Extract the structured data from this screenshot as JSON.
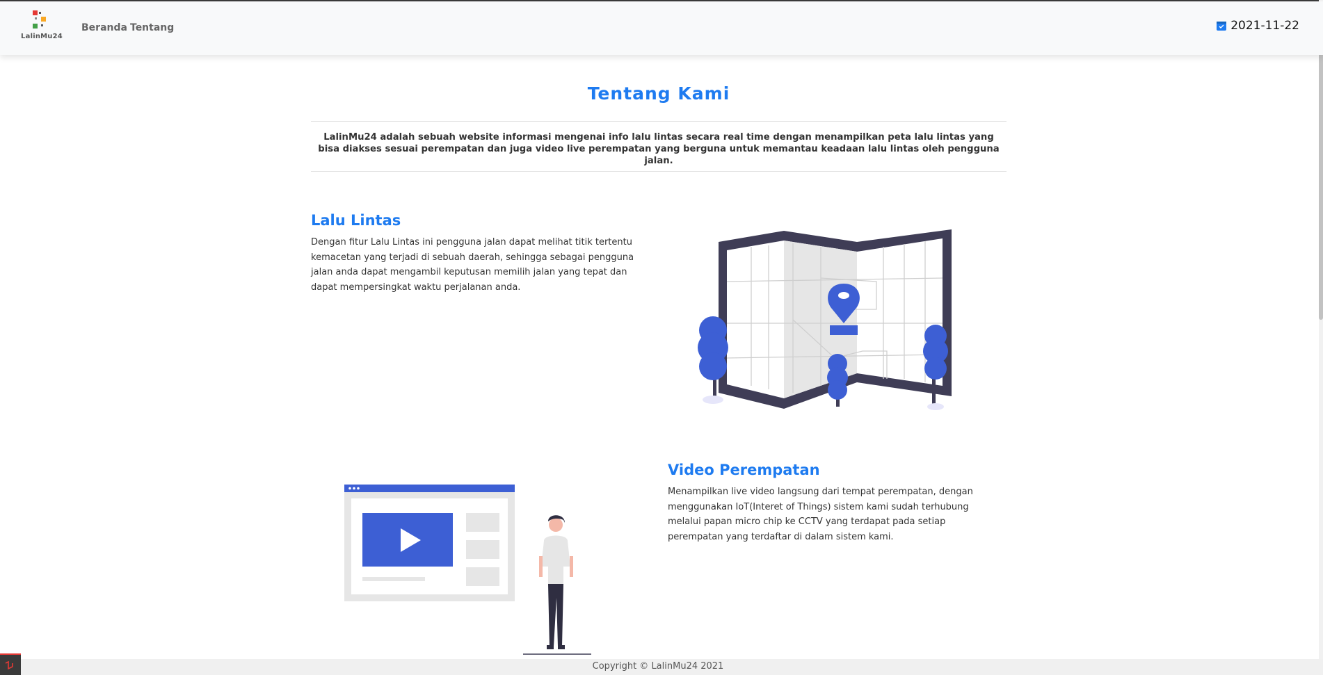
{
  "brand": {
    "name": "LalinMu24"
  },
  "nav": {
    "items": [
      {
        "label": "Beranda"
      },
      {
        "label": "Tentang"
      }
    ]
  },
  "header": {
    "date": "2021-11-22"
  },
  "about": {
    "title": "Tentang Kami",
    "intro": "LalinMu24 adalah sebuah website informasi mengenai info lalu lintas secara real time dengan menampilkan peta lalu lintas yang bisa diakses sesuai perempatan dan juga video live perempatan yang berguna untuk memantau keadaan lalu lintas oleh pengguna jalan."
  },
  "sections": [
    {
      "title": "Lalu Lintas",
      "text": "Dengan fitur Lalu Lintas ini pengguna jalan dapat melihat titik tertentu kemacetan yang terjadi di sebuah daerah, sehingga sebagai pengguna jalan anda dapat mengambil keputusan memilih jalan yang tepat dan dapat mempersingkat waktu perjalanan anda.",
      "illustration": "map-illustration"
    },
    {
      "title": "Video Perempatan",
      "text": "Menampilkan live video langsung dari tempat perempatan, dengan menggunakan IoT(Interet of Things) sistem kami sudah terhubung melalui papan micro chip ke CCTV yang terdapat pada setiap perempatan yang terdaftar di dalam sistem kami.",
      "illustration": "video-illustration"
    }
  ],
  "footer": {
    "copyright": "Copyright © LalinMu24 2021"
  },
  "colors": {
    "accent": "#1e7bf0",
    "illustration": "#3d5fd4",
    "frame": "#3f3d56"
  }
}
